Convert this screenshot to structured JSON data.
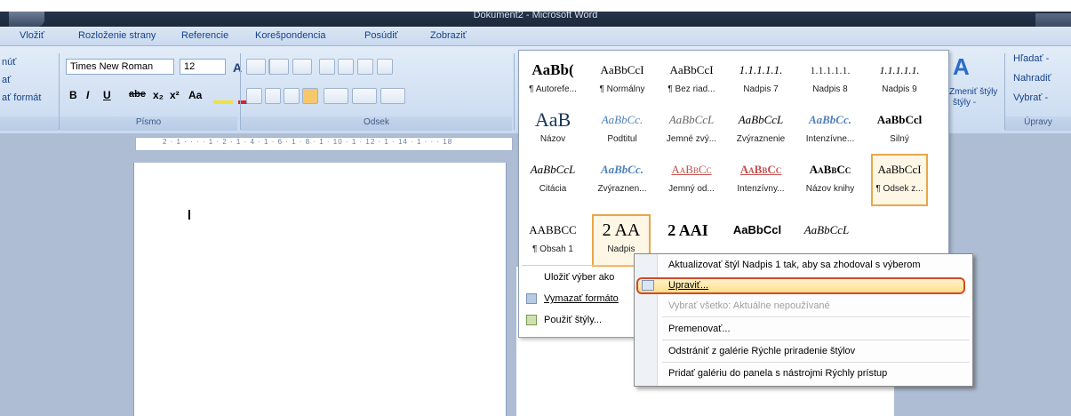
{
  "window": {
    "title": "Dokument2 - Microsoft Word"
  },
  "tabs": [
    "Vložiť",
    "Rozloženie strany",
    "Referencie",
    "Korešpondencia",
    "Posúdiť",
    "Zobraziť"
  ],
  "clipboard": {
    "items": [
      "núť",
      "ať",
      "ať formát"
    ]
  },
  "font": {
    "name": "Times New Roman",
    "size": "12",
    "label": "Písmo",
    "bold": "B",
    "italic": "I",
    "underline": "U",
    "strike": "abe",
    "sub": "x₂",
    "sup": "x²",
    "case": "Aa",
    "grow": "A",
    "shrink": "A"
  },
  "paragraph": {
    "label": "Odsek"
  },
  "ruler": {
    "text": "2 · 1 · · · · 1 · 2 · 1 · 4 · 1 · 6 · 1 · 8 · 1 · 10 · 1 · 12 · 1 · 14 · 1 · · · 18"
  },
  "styles": {
    "row1": [
      {
        "sample": "AaBb(",
        "name": "¶ Autorefe..."
      },
      {
        "sample": "AaBbCcI",
        "name": "¶ Normálny"
      },
      {
        "sample": "AaBbCcI",
        "name": "¶ Bez riad..."
      },
      {
        "sample": "1.1.1.1.1.",
        "name": "Nadpis 7"
      },
      {
        "sample": "1.1.1.1.1.",
        "name": "Nadpis 8"
      },
      {
        "sample": "1.1.1.1.1.",
        "name": "Nadpis 9"
      }
    ],
    "row2": [
      {
        "sample": "AaB",
        "name": "Názov"
      },
      {
        "sample": "AaBbCc.",
        "name": "Podtitul"
      },
      {
        "sample": "AaBbCcL",
        "name": "Jemné zvý..."
      },
      {
        "sample": "AaBbCcL",
        "name": "Zvýraznenie"
      },
      {
        "sample": "AaBbCc.",
        "name": "Intenzívne..."
      },
      {
        "sample": "AaBbCcl",
        "name": "Silný"
      }
    ],
    "row3": [
      {
        "sample": "AaBbCcL",
        "name": "Citácia"
      },
      {
        "sample": "AaBbCc.",
        "name": "Zvýraznen..."
      },
      {
        "sample": "AaBbCc",
        "name": "Jemný od..."
      },
      {
        "sample": "AaBbCc",
        "name": "Intenzívny..."
      },
      {
        "sample": "AaBbCc",
        "name": "Názov knihy"
      },
      {
        "sample": "AaBbCcI",
        "name": "¶ Odsek z..."
      }
    ],
    "row4": [
      {
        "sample": "AABBCC",
        "name": "¶ Obsah 1"
      },
      {
        "sample": "2 AA",
        "name": "Nadpis"
      },
      {
        "sample": "2 AAI",
        "name": ""
      },
      {
        "sample": "AaBbCcl",
        "name": ""
      },
      {
        "sample": "AaBbCcL",
        "name": ""
      }
    ],
    "change_label": "Zmeniť štýly",
    "change_sub": "štýly -"
  },
  "gallery_menu": {
    "save": "Uložiť výber ako",
    "clear": "Vymazať formáto",
    "apply": "Použiť štýly..."
  },
  "context_menu": {
    "update": "Aktualizovať štýl Nadpis 1 tak, aby sa zhodoval s výberom",
    "modify": "Upraviť...",
    "select_all": "Vybrať všetko: Aktuálne nepoužívané",
    "rename": "Premenovať...",
    "remove": "Odstrániť z galérie Rýchle priradenie štýlov",
    "add_qat": "Pridať galériu do panela s nástrojmi Rýchly prístup"
  },
  "editing": {
    "find": "Hľadať -",
    "replace": "Nahradiť",
    "select": "Vybrať -",
    "label": "Úpravy"
  }
}
